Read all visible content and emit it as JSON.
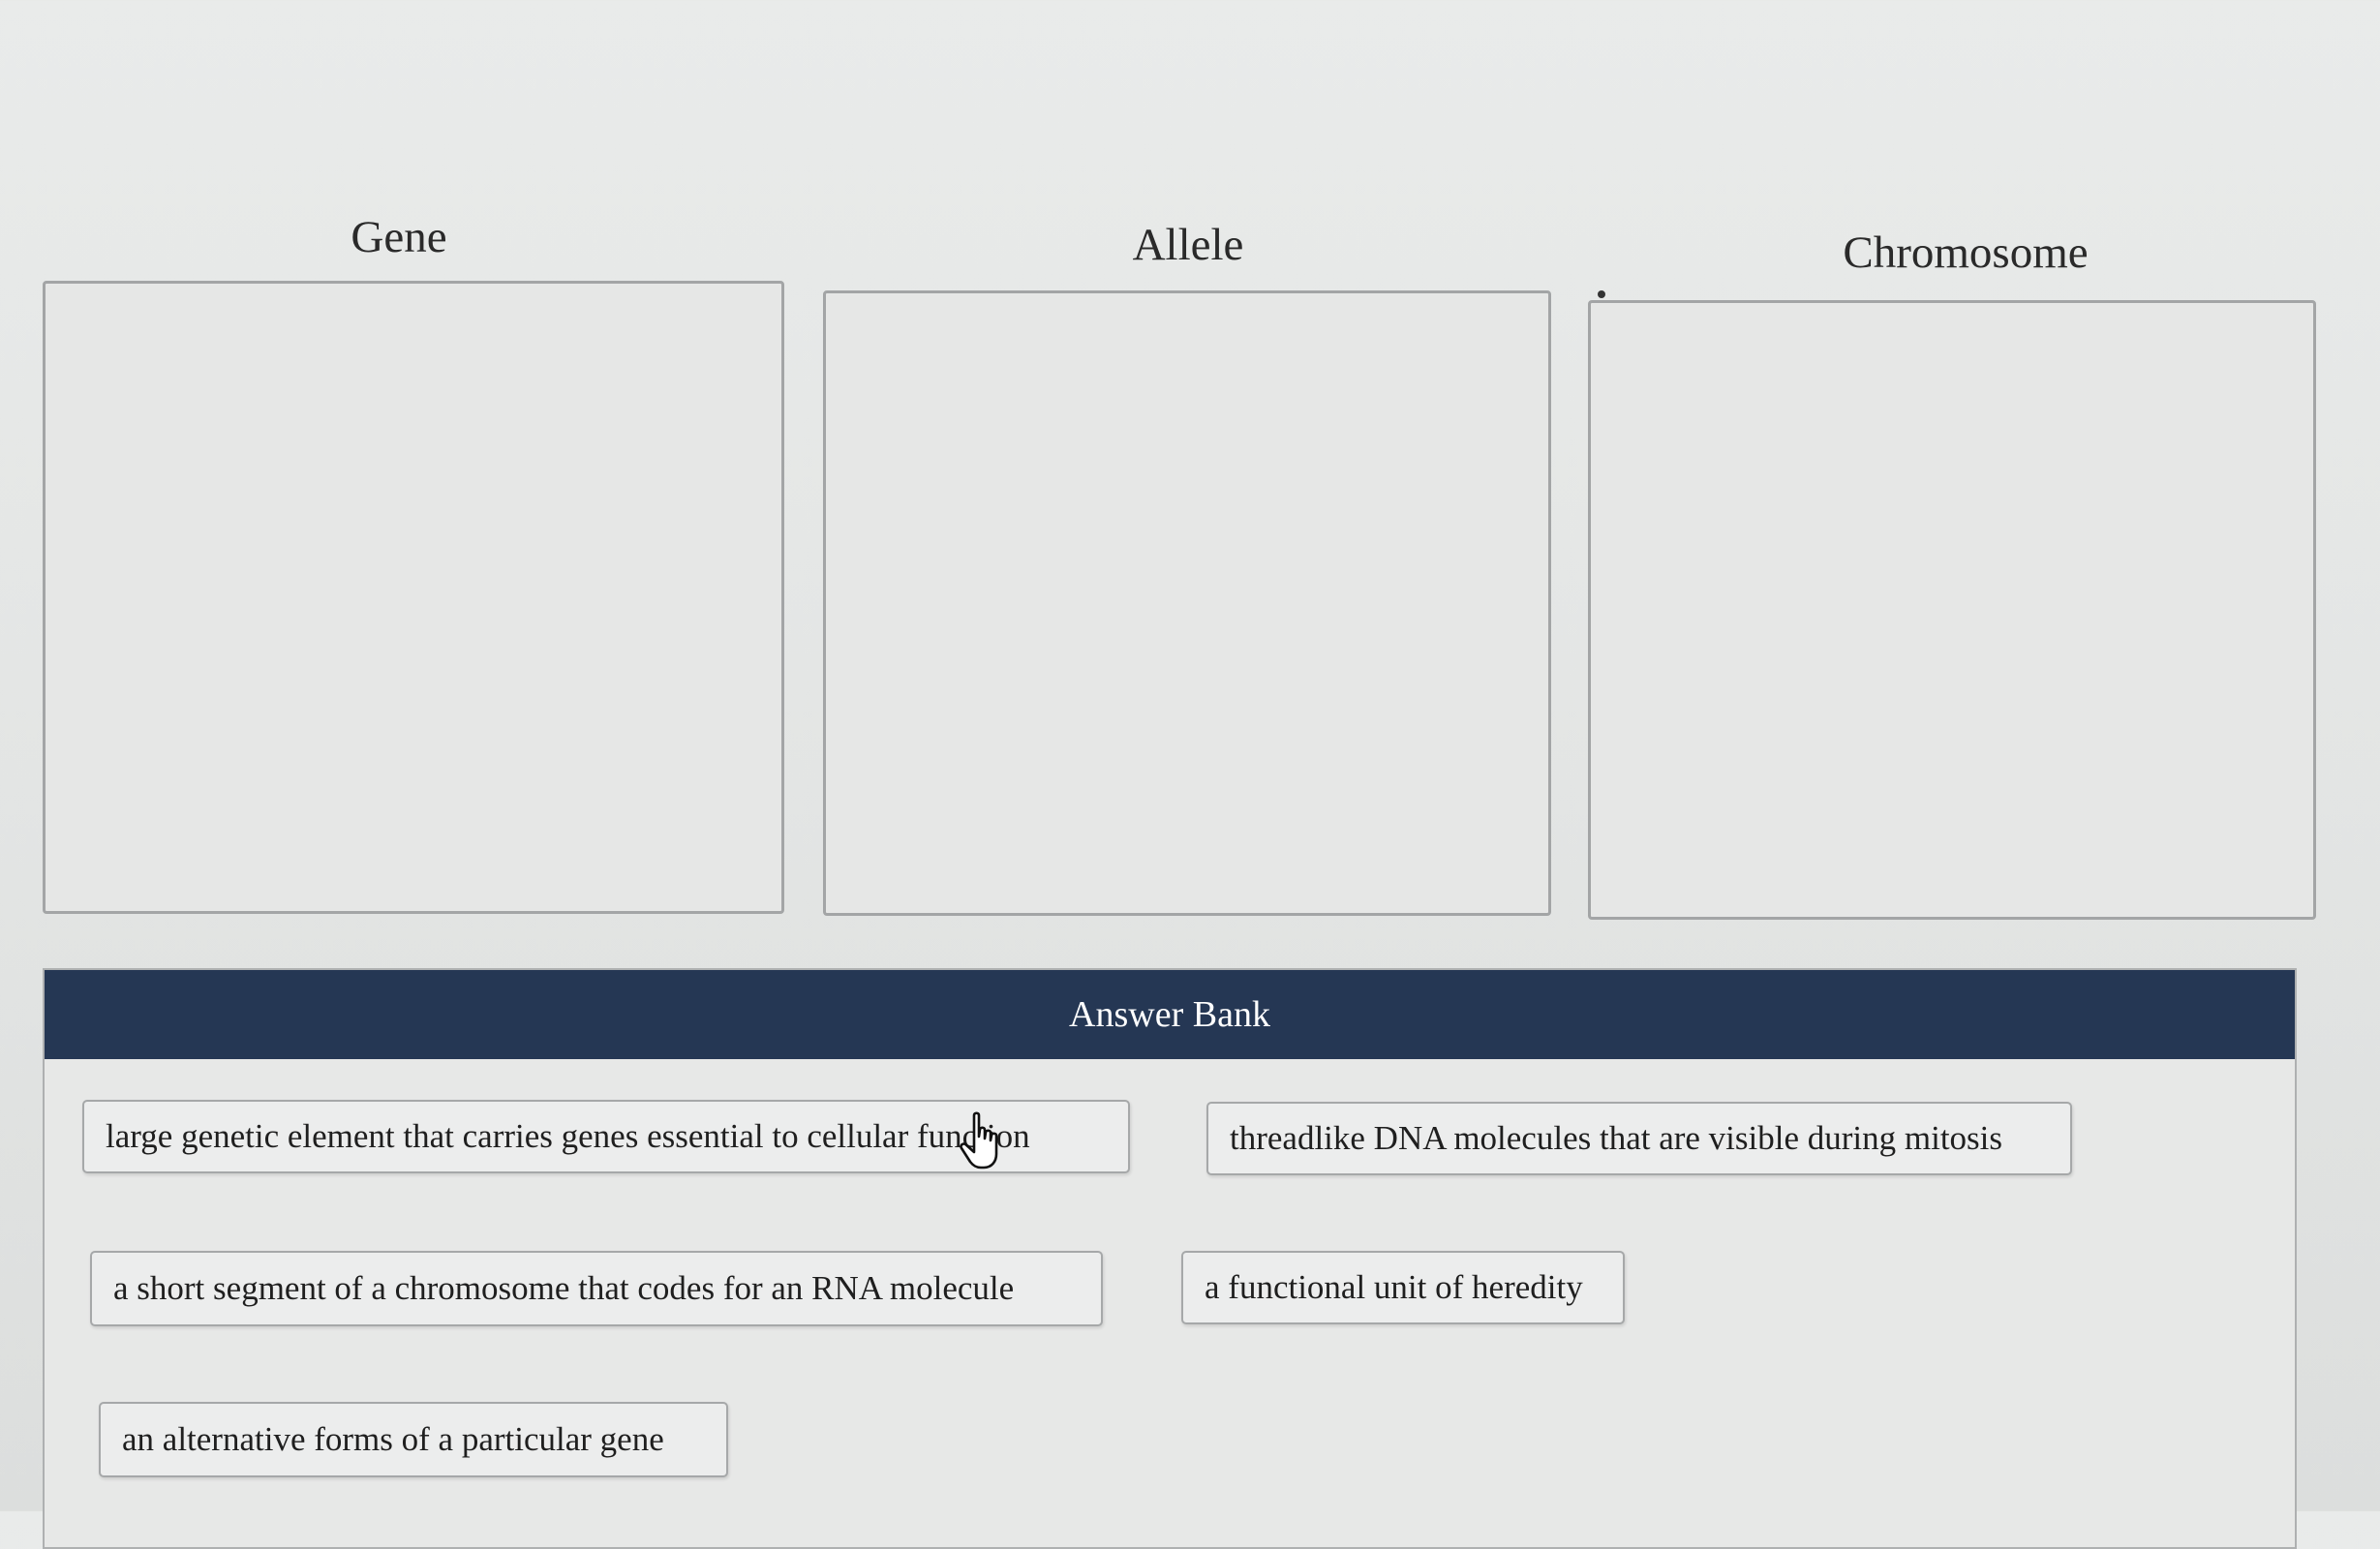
{
  "categories": [
    {
      "title": "Gene"
    },
    {
      "title": "Allele"
    },
    {
      "title": "Chromosome"
    }
  ],
  "answer_bank": {
    "header": "Answer Bank",
    "items": [
      {
        "text": "large genetic element that carries genes essential to cellular function"
      },
      {
        "text": "threadlike DNA molecules that are visible during mitosis"
      },
      {
        "text": "a short segment of a chromosome that codes for an RNA molecule"
      },
      {
        "text": "a functional unit of heredity"
      },
      {
        "text": "an alternative forms of a particular gene"
      }
    ]
  },
  "colors": {
    "header_bg": "#253754",
    "header_text": "#ffffff",
    "page_bg": "#e6e8e7"
  },
  "icons": {
    "cursor": "hand-pointer-icon"
  }
}
